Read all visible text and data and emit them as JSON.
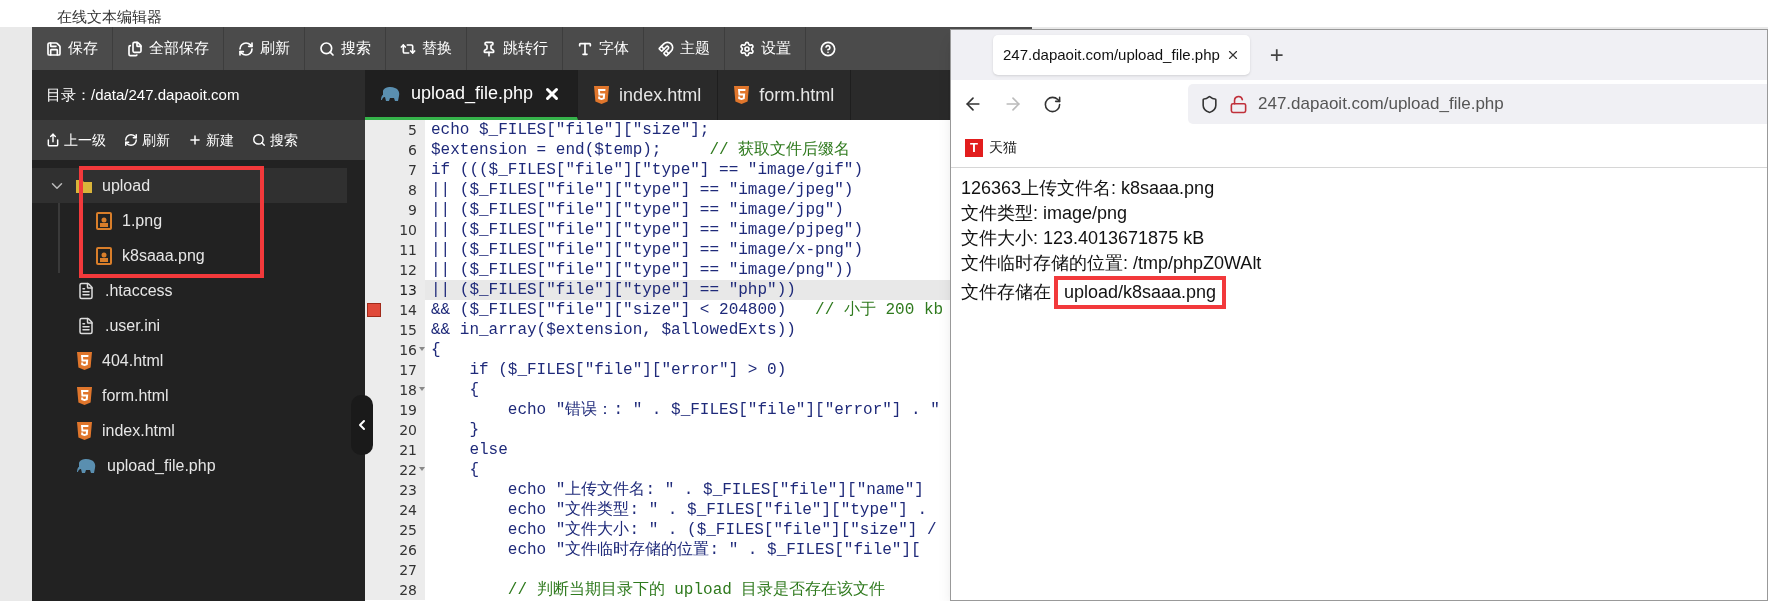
{
  "page_title": "在线文本编辑器",
  "toolbar": [
    "保存",
    "全部保存",
    "刷新",
    "搜索",
    "替换",
    "跳转行",
    "字体",
    "主题",
    "设置"
  ],
  "sidebar": {
    "directory": "目录：/data/247.dapaoit.com",
    "actions": [
      "上一级",
      "刷新",
      "新建",
      "搜索"
    ],
    "tree": [
      {
        "name": "upload",
        "kind": "folder",
        "expanded": true,
        "selected": true,
        "marked": true,
        "children": [
          {
            "name": "1.png",
            "kind": "image",
            "selected": false
          },
          {
            "name": "k8saaa.png",
            "kind": "image",
            "selected": false
          }
        ]
      },
      {
        "name": ".htaccess",
        "kind": "text",
        "selected": false
      },
      {
        "name": ".user.ini",
        "kind": "text",
        "selected": false
      },
      {
        "name": "404.html",
        "kind": "html",
        "selected": false
      },
      {
        "name": "form.html",
        "kind": "html",
        "selected": false
      },
      {
        "name": "index.html",
        "kind": "html",
        "selected": false
      },
      {
        "name": "upload_file.php",
        "kind": "php",
        "selected": false
      }
    ]
  },
  "tabs": [
    {
      "label": "upload_file.php",
      "kind": "php",
      "selected": true,
      "closable": true
    },
    {
      "label": "index.html",
      "kind": "html",
      "selected": false,
      "closable": false
    },
    {
      "label": "form.html",
      "kind": "html",
      "selected": false,
      "closable": false
    }
  ],
  "code": [
    {
      "n": "5",
      "code": "echo $_FILES[\"file\"][\"size\"];"
    },
    {
      "n": "6",
      "code": "$extension = end($temp);     ",
      "comment": "// 获取文件后缀名"
    },
    {
      "n": "7",
      "code": "if ((($_FILES[\"file\"][\"type\"] == \"image/gif\")"
    },
    {
      "n": "8",
      "code": "|| ($_FILES[\"file\"][\"type\"] == \"image/jpeg\")"
    },
    {
      "n": "9",
      "code": "|| ($_FILES[\"file\"][\"type\"] == \"image/jpg\")"
    },
    {
      "n": "10",
      "code": "|| ($_FILES[\"file\"][\"type\"] == \"image/pjpeg\")"
    },
    {
      "n": "11",
      "code": "|| ($_FILES[\"file\"][\"type\"] == \"image/x-png\")"
    },
    {
      "n": "12",
      "code": "|| ($_FILES[\"file\"][\"type\"] == \"image/png\"))"
    },
    {
      "n": "13",
      "code": "|| ($_FILES[\"file\"][\"type\"] == \"php\"))",
      "active": true
    },
    {
      "n": "14",
      "code": "&& ($_FILES[\"file\"][\"size\"] < 204800)   ",
      "comment": "// 小于 200 kb",
      "error": true
    },
    {
      "n": "15",
      "code": "&& in_array($extension, $allowedExts))"
    },
    {
      "n": "16",
      "code": "{",
      "fold": true
    },
    {
      "n": "17",
      "code": "    if ($_FILES[\"file\"][\"error\"] > 0)"
    },
    {
      "n": "18",
      "code": "    {",
      "fold": true
    },
    {
      "n": "19",
      "code": "        echo \"错误：: \" . $_FILES[\"file\"][\"error\"] . \""
    },
    {
      "n": "20",
      "code": "    }"
    },
    {
      "n": "21",
      "code": "    else"
    },
    {
      "n": "22",
      "code": "    {",
      "fold": true
    },
    {
      "n": "23",
      "code": "        echo \"上传文件名: \" . $_FILES[\"file\"][\"name\"]"
    },
    {
      "n": "24",
      "code": "        echo \"文件类型: \" . $_FILES[\"file\"][\"type\"] ."
    },
    {
      "n": "25",
      "code": "        echo \"文件大小: \" . ($_FILES[\"file\"][\"size\"] /"
    },
    {
      "n": "26",
      "code": "        echo \"文件临时存储的位置: \" . $_FILES[\"file\"]["
    },
    {
      "n": "27"
    },
    {
      "n": "28",
      "comment": "        // 判断当期目录下的 upload 目录是否存在该文件"
    }
  ],
  "browser": {
    "tab_title": "247.dapaoit.com/upload_file.php",
    "new_tab": "+",
    "url": "247.dapaoit.com/upload_file.php",
    "forward_disabled": true,
    "bookmarks": [
      {
        "label": "天猫",
        "icon": "T"
      }
    ],
    "lines": [
      "126363上传文件名: k8saaa.png",
      "文件类型: image/png",
      "文件大小: 123.4013671875 kB",
      "文件临时存储的位置: /tmp/phpZ0WAlt"
    ],
    "stored": {
      "prefix": "文件存储在",
      "path": "upload/k8saaa.png",
      "marked": true
    }
  }
}
